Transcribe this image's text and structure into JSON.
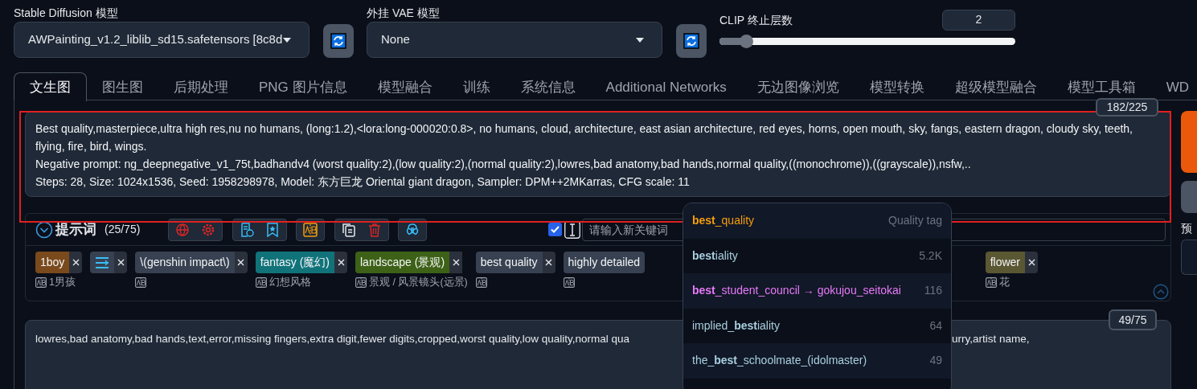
{
  "settings": {
    "sd_model": {
      "label": "Stable Diffusion 模型",
      "value": "AWPainting_v1.2_liblib_sd15.safetensors [8c8d"
    },
    "vae": {
      "label": "外挂 VAE 模型",
      "value": "None"
    },
    "clip": {
      "label": "CLIP 终止层数",
      "value": "2",
      "level": 0.09
    }
  },
  "tabs": [
    {
      "label": "文生图",
      "selected": true
    },
    {
      "label": "图生图",
      "selected": false
    },
    {
      "label": "后期处理",
      "selected": false
    },
    {
      "label": "PNG 图片信息",
      "selected": false
    },
    {
      "label": "模型融合",
      "selected": false
    },
    {
      "label": "训练",
      "selected": false
    },
    {
      "label": "系统信息",
      "selected": false
    },
    {
      "label": "Additional Networks",
      "selected": false
    },
    {
      "label": "无边图像浏览",
      "selected": false
    },
    {
      "label": "模型转换",
      "selected": false
    },
    {
      "label": "超级模型融合",
      "selected": false
    },
    {
      "label": "模型工具箱",
      "selected": false
    },
    {
      "label": "WD",
      "selected": false
    }
  ],
  "prompt": {
    "counter": "182/225",
    "lines": [
      "Best quality,masterpiece,ultra high res,nu no humans, (long:1.2),<lora:long-000020:0.8>, no humans, cloud, architecture, east asian architecture, red eyes, horns, open mouth, sky, fangs, eastern dragon, cloudy sky, teeth, flying, fire, bird, wings.",
      "Negative prompt: ng_deepnegative_v1_75t,badhandv4 (worst quality:2),(low quality:2),(normal quality:2),lowres,bad anatomy,bad hands,normal quality,((monochrome)),((grayscale)),nsfw,..",
      "Steps: 28, Size: 1024x1536, Seed: 1958298978, Model: 东方巨龙 Oriental giant dragon, Sampler: DPM++2MKarras, CFG scale: 11"
    ]
  },
  "tag_panel": {
    "title": "提示词",
    "count": "(25/75)",
    "auto_add": {
      "checked": true
    },
    "keyword_field": {
      "placeholder": "请输入新关键词"
    },
    "tags": [
      {
        "kind": "text",
        "label": "1boy",
        "color": "#7a4a1c",
        "removable": true,
        "translation": "1男孩"
      },
      {
        "kind": "icon",
        "color": "#374151",
        "removable": true
      },
      {
        "kind": "text",
        "label": "\\(genshin impact\\)",
        "color": "#374151",
        "removable": true
      },
      {
        "kind": "text",
        "label": "fantasy (魔幻)",
        "color": "#11737a",
        "removable": true,
        "translation": "幻想风格"
      },
      {
        "kind": "text",
        "label": "landscape (景观)",
        "color": "#3d6116",
        "removable": true,
        "translation": "景观 / 风景镜头(远景)"
      },
      {
        "kind": "text",
        "label": "best quality",
        "color": "#374151",
        "removable": true
      },
      {
        "kind": "text",
        "label": "highly detailed",
        "color": "#374151",
        "removable": false
      },
      {
        "kind": "text",
        "label": "flower",
        "color": "#5a5733",
        "removable": true,
        "translation": "花"
      }
    ]
  },
  "negative_prompt": {
    "counter": "49/75",
    "text_before": "lowres,bad anatomy,bad hands,text,error,missing fingers,extra digit,fewer digits,cropped,worst quality,low quality,normal qua",
    "text_after": "urry,artist name,"
  },
  "side": {
    "label": "预"
  },
  "autocomplete": [
    {
      "text": "**best**_quality",
      "count": "Quality tag",
      "color": "#f59e0b"
    },
    {
      "text": "**best**iality",
      "count": "5.2K",
      "color": "#a8d0e0"
    },
    {
      "text": "**best**_student_council → gokujou_seitokai",
      "count": "116",
      "color": "#e879f9"
    },
    {
      "text": "implied_**best**iality",
      "count": "64",
      "color": "#a8d0e0"
    },
    {
      "text": "the_**best**_schoolmate_(idolmaster)",
      "count": "49",
      "color": "#a8d0e0"
    }
  ]
}
